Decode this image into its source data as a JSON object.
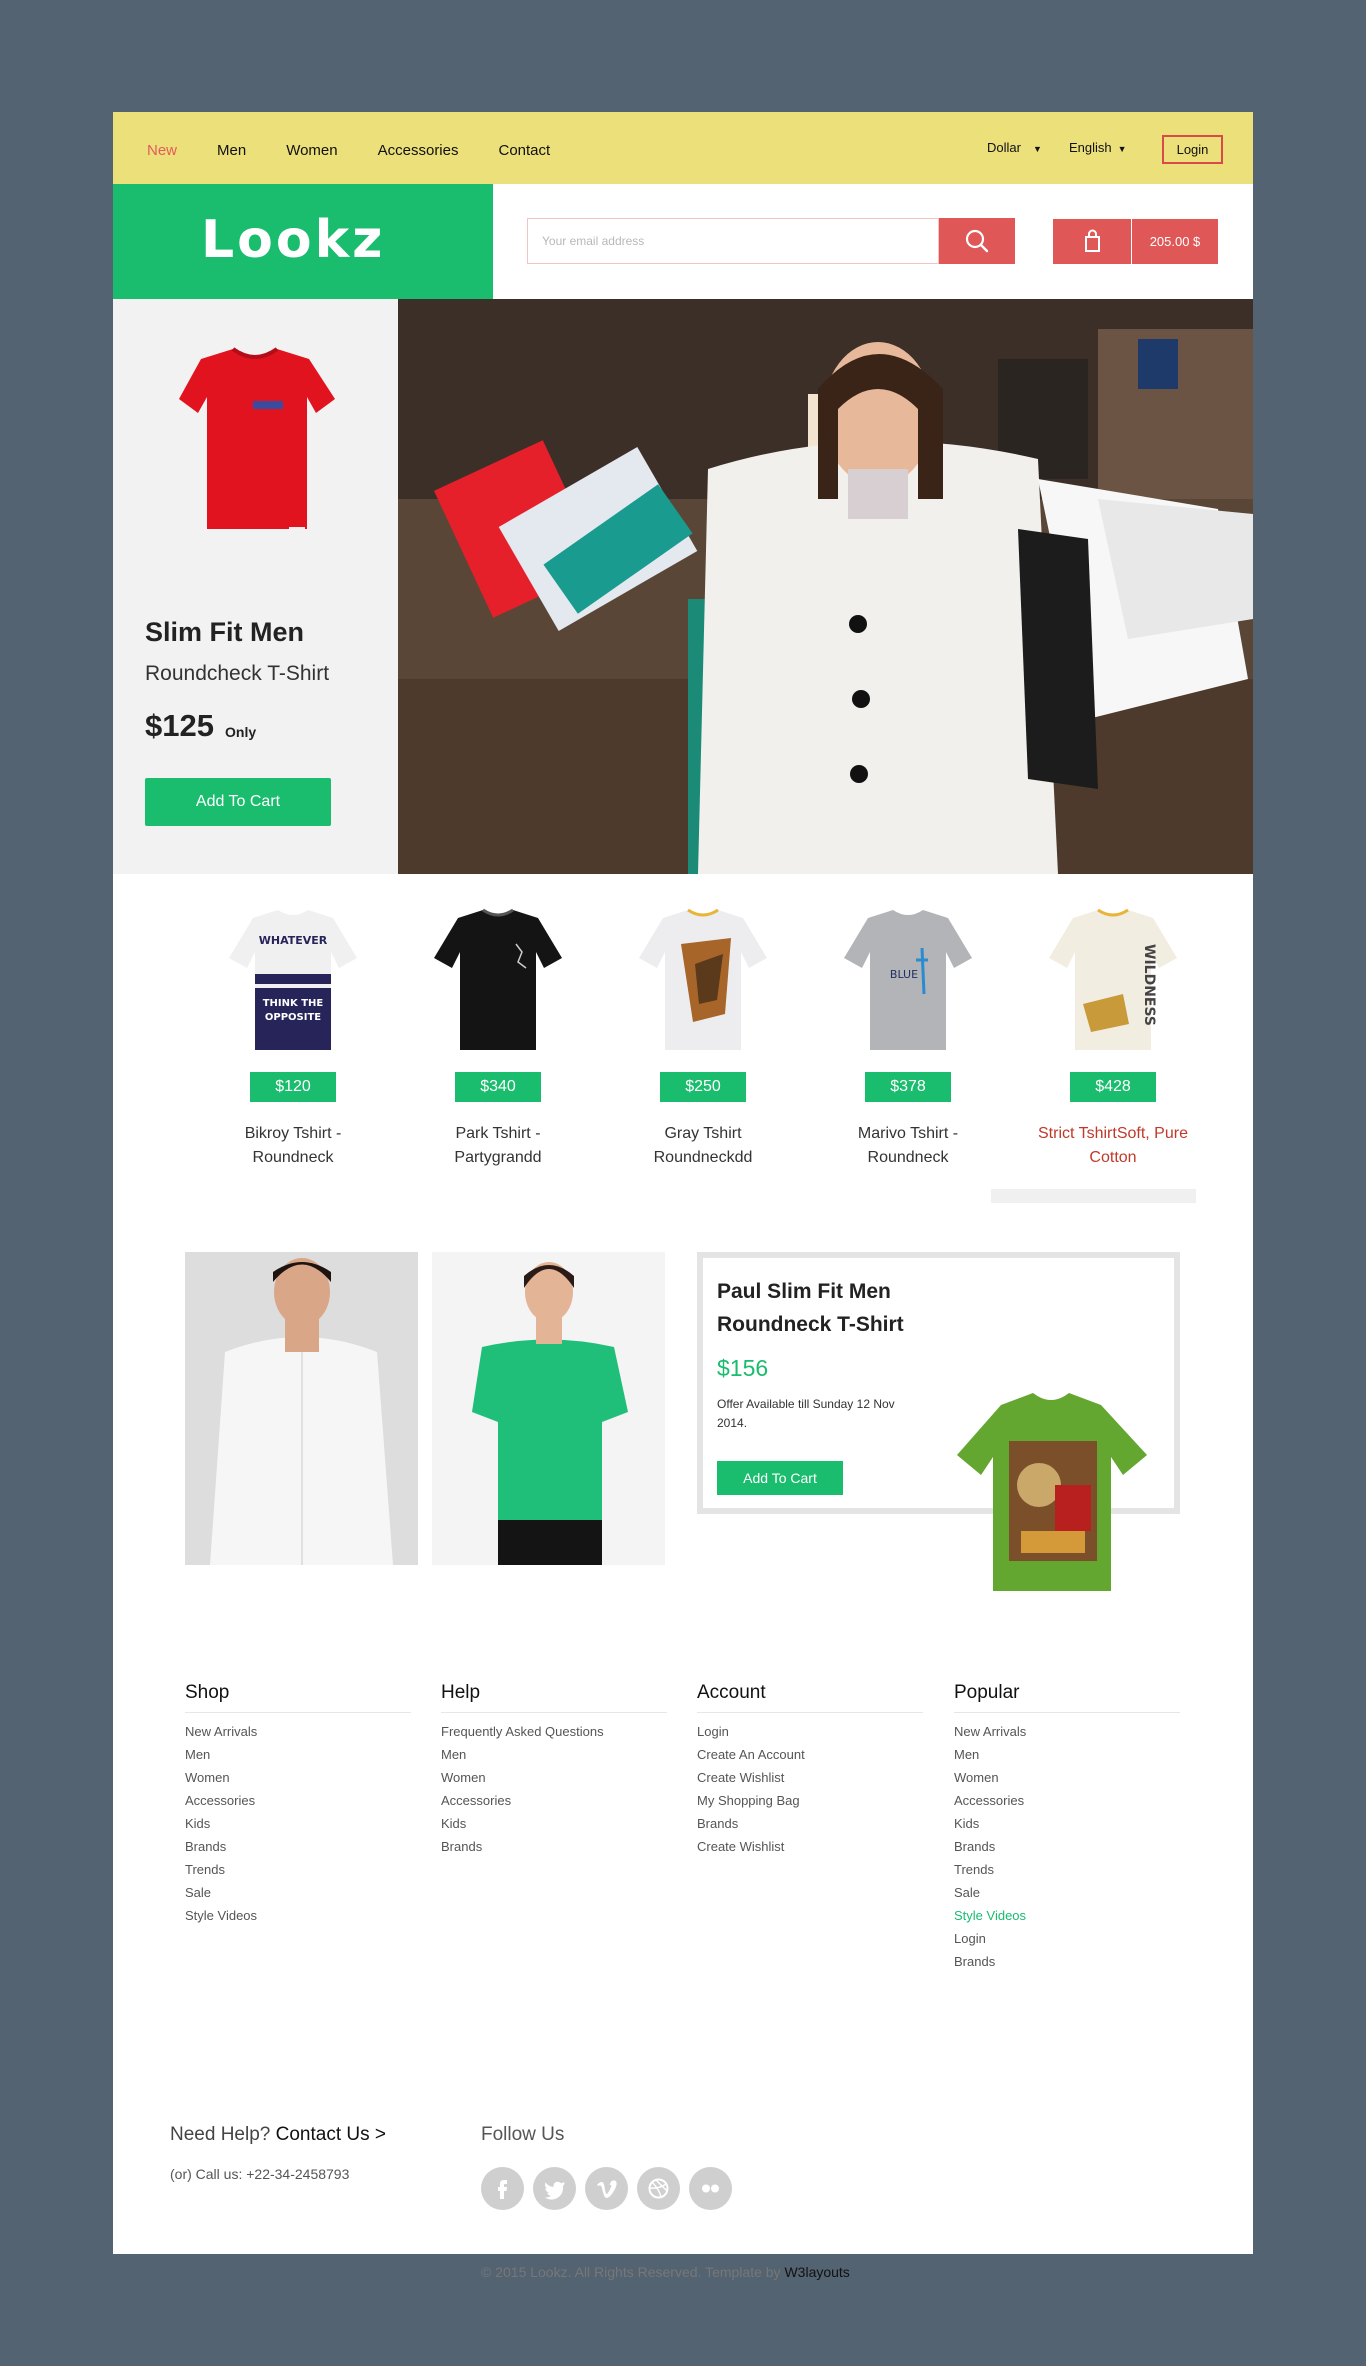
{
  "nav": {
    "items": [
      {
        "label": "New",
        "active": true
      },
      {
        "label": "Men",
        "active": false
      },
      {
        "label": "Women",
        "active": false
      },
      {
        "label": "Accessories",
        "active": false
      },
      {
        "label": "Contact",
        "active": false
      }
    ],
    "currency": "Dollar",
    "language": "English",
    "login": "Login"
  },
  "header": {
    "logo": "Lookz",
    "search_placeholder": "Your email address",
    "cart_total": "205.00 $"
  },
  "hero": {
    "title": "Slim Fit Men",
    "subtitle": "Roundcheck T-Shirt",
    "price": "$125",
    "price_note": "Only",
    "cta": "Add To Cart"
  },
  "products": [
    {
      "price": "$120",
      "name_line1": "Bikroy Tshirt -",
      "name_line2": "Roundneck"
    },
    {
      "price": "$340",
      "name_line1": "Park Tshirt -",
      "name_line2": "Partygrandd"
    },
    {
      "price": "$250",
      "name_line1": "Gray Tshirt",
      "name_line2": "Roundneckdd"
    },
    {
      "price": "$378",
      "name_line1": "Marivo Tshirt -",
      "name_line2": "Roundneck"
    },
    {
      "price": "$428",
      "name_line1": "Strict TshirtSoft, Pure",
      "name_line2": "Cotton"
    }
  ],
  "offer": {
    "title": "Paul Slim Fit Men Roundneck T-Shirt",
    "price": "$156",
    "note": "Offer Available till Sunday 12 Nov 2014.",
    "cta": "Add To Cart"
  },
  "footer": {
    "shop": {
      "title": "Shop",
      "links": [
        "New Arrivals",
        "Men",
        "Women",
        "Accessories",
        "Kids",
        "Brands",
        "Trends",
        "Sale",
        "Style Videos"
      ]
    },
    "help": {
      "title": "Help",
      "links": [
        "Frequently Asked Questions",
        "Men",
        "Women",
        "Accessories",
        "Kids",
        "Brands"
      ]
    },
    "account": {
      "title": "Account",
      "links": [
        "Login",
        "Create An Account",
        "Create Wishlist",
        "My Shopping Bag",
        "Brands",
        "Create Wishlist"
      ]
    },
    "popular": {
      "title": "Popular",
      "links": [
        "New Arrivals",
        "Men",
        "Women",
        "Accessories",
        "Kids",
        "Brands",
        "Trends",
        "Sale",
        "Style Videos",
        "Login",
        "Brands"
      ]
    },
    "need_help": "Need Help?",
    "contact_link": "Contact Us >",
    "call_us": "(or) Call us: +22-34-2458793",
    "follow_us": "Follow Us",
    "social_icons": [
      "facebook-icon",
      "twitter-icon",
      "vimeo-icon",
      "dribbble-icon",
      "flickr-icon"
    ],
    "copyright": "© 2015 Lookz. All Rights Reserved. Template by",
    "copyright_link": "W3layouts"
  },
  "colors": {
    "accent_green": "#1abc6e",
    "accent_red": "#e05757",
    "topbar_yellow": "#ece07a"
  }
}
